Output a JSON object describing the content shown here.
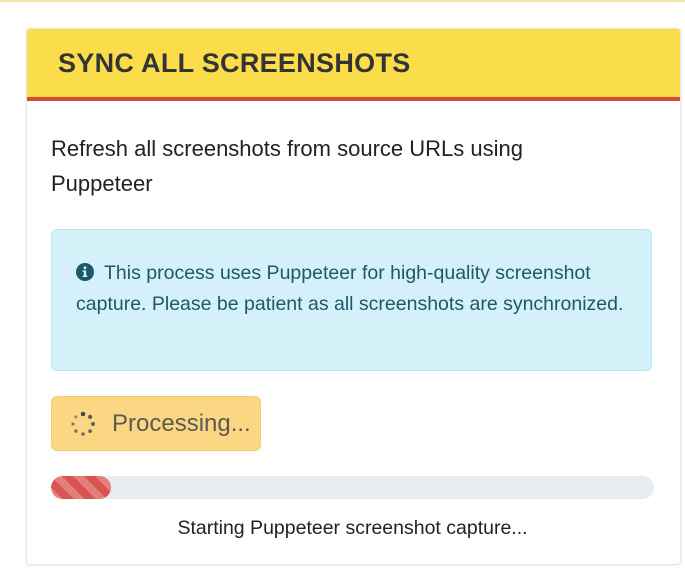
{
  "card": {
    "title": "SYNC ALL SCREENSHOTS",
    "description": "Refresh all screenshots from source URLs using Puppeteer"
  },
  "alert": {
    "icon": "info-circle-icon",
    "text": "This process uses Puppeteer for high-quality screenshot capture. Please be patient as all screenshots are synchronized."
  },
  "button": {
    "label": "Processing...",
    "icon": "spinner-icon",
    "state": "disabled"
  },
  "progress": {
    "percent": 10,
    "status_text": "Starting Puppeteer screenshot capture..."
  },
  "colors": {
    "header_bg": "#fbdd4c",
    "header_border": "#d64a3a",
    "alert_bg": "#d4f1f9",
    "alert_text": "#1e5866",
    "button_bg": "#fbd683",
    "progress_fill": "#d9534f",
    "progress_track": "#e9ecef"
  }
}
